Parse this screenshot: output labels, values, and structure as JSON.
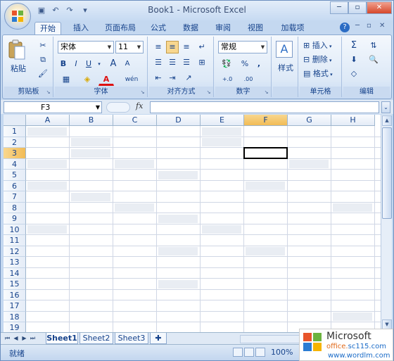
{
  "window": {
    "title": "Book1 - Microsoft Excel",
    "controls": {
      "minimize": "─",
      "restore": "▫",
      "close": "✕"
    }
  },
  "quick_access": {
    "save_icon": "save-icon",
    "undo_icon": "undo-icon",
    "redo_icon": "redo-icon",
    "customize_icon": "dropdown-icon"
  },
  "ribbon_tabs": [
    "开始",
    "插入",
    "页面布局",
    "公式",
    "数据",
    "审阅",
    "视图",
    "加载项"
  ],
  "active_tab": "开始",
  "ribbon": {
    "clipboard": {
      "label": "剪贴板",
      "paste": "粘贴"
    },
    "font": {
      "label": "字体",
      "font_name": "宋体",
      "font_size": "11",
      "bold": "B",
      "italic": "I",
      "underline": "U",
      "grow": "A",
      "shrink": "A",
      "phonetic": "wén"
    },
    "alignment": {
      "label": "对齐方式"
    },
    "number": {
      "label": "数字",
      "format": "常规",
      "percent": "%",
      "comma": ",",
      "inc_decimal": "+.0",
      "dec_decimal": ".00"
    },
    "styles": {
      "label": "样式"
    },
    "cells": {
      "label": "单元格",
      "insert": "插入",
      "delete": "删除",
      "format": "格式"
    },
    "editing": {
      "label": "编辑",
      "sum": "Σ"
    }
  },
  "formula_bar": {
    "name_box": "F3",
    "fx": "fx",
    "formula": ""
  },
  "grid": {
    "columns": [
      "A",
      "B",
      "C",
      "D",
      "E",
      "F",
      "G",
      "H"
    ],
    "rows": [
      "1",
      "2",
      "3",
      "4",
      "5",
      "6",
      "7",
      "8",
      "9",
      "10",
      "11",
      "12",
      "13",
      "14",
      "15",
      "16",
      "17",
      "18",
      "19"
    ],
    "active_cell": "F3",
    "selected_column": "F",
    "selected_row": "3"
  },
  "sheets": [
    "Sheet1",
    "Sheet2",
    "Sheet3"
  ],
  "active_sheet": "Sheet1",
  "status": {
    "text": "就绪",
    "zoom": "100%"
  },
  "watermark": {
    "brand": "Microsoft",
    "site_prefix": "office.",
    "site_suffix": "sc115.com",
    "word": "www.wordlm.com"
  },
  "colors": {
    "accent": "#f2bb55",
    "ribbon": "#dde9f7",
    "frame": "#c4d8f0"
  }
}
